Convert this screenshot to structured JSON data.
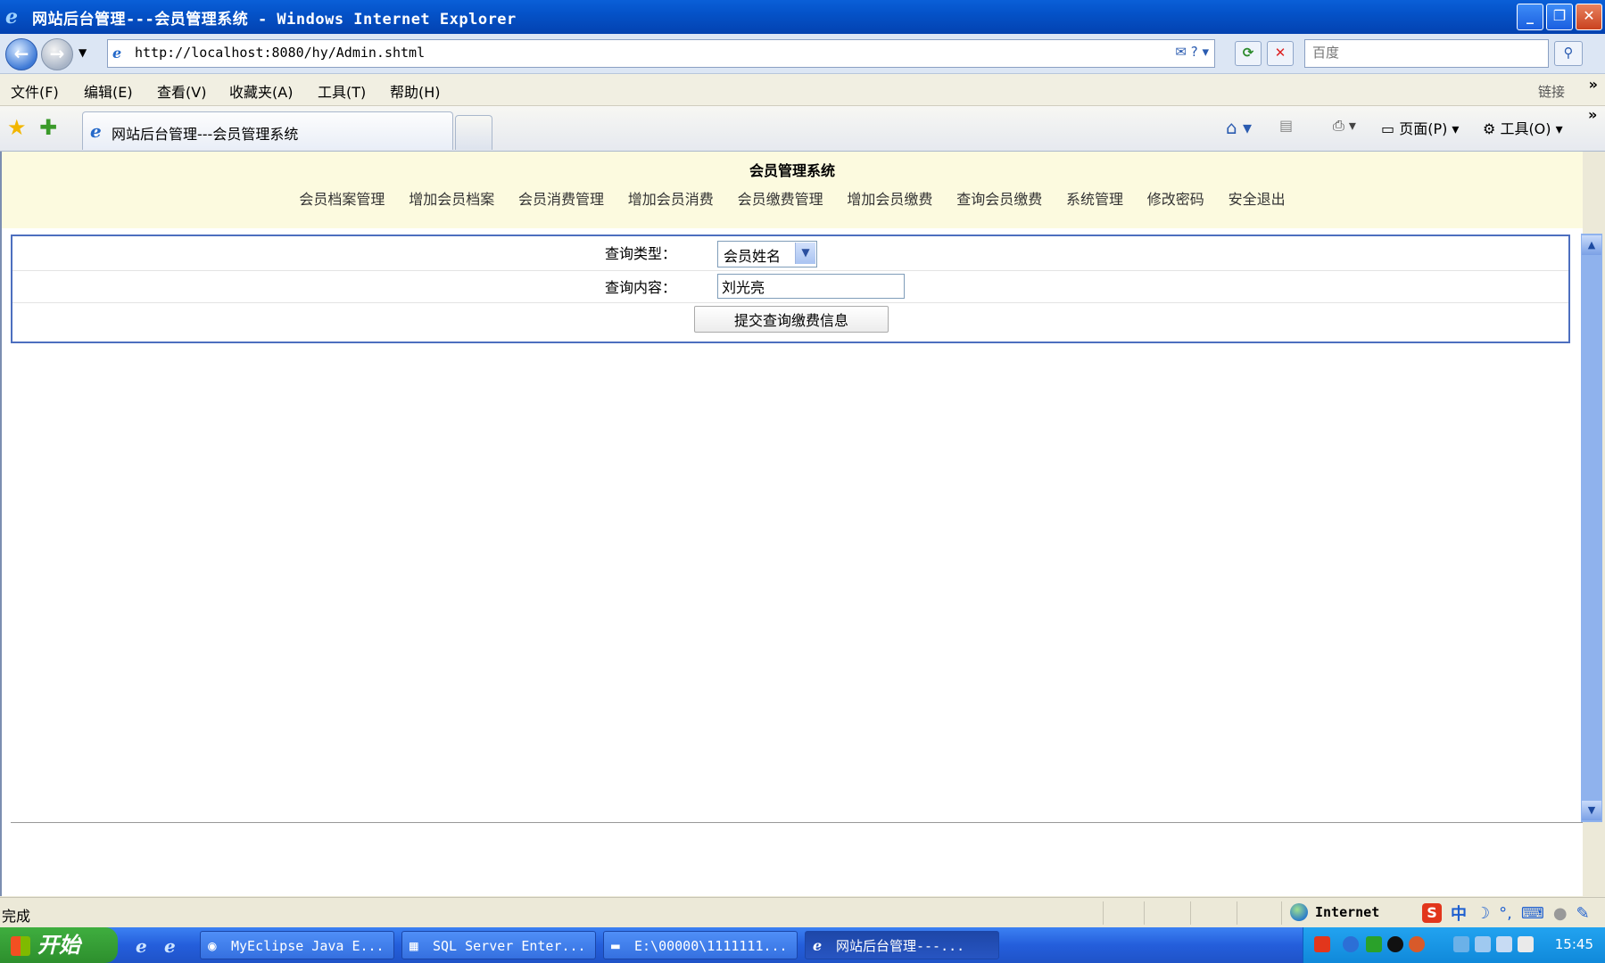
{
  "window": {
    "title": "网站后台管理---会员管理系统 - Windows Internet Explorer"
  },
  "addressbar": {
    "url": "http://localhost:8080/hy/Admin.shtml",
    "search_placeholder": "百度"
  },
  "menubar": {
    "items": [
      "文件(F)",
      "编辑(E)",
      "查看(V)",
      "收藏夹(A)",
      "工具(T)",
      "帮助(H)"
    ],
    "links_label": "链接"
  },
  "tabs": {
    "active_label": "网站后台管理---会员管理系统",
    "page_label": "页面(P)",
    "tools_label": "工具(O)"
  },
  "page": {
    "system_title": "会员管理系统",
    "nav": [
      "会员档案管理",
      "增加会员档案",
      "会员消费管理",
      "增加会员消费",
      "会员缴费管理",
      "增加会员缴费",
      "查询会员缴费",
      "系统管理",
      "修改密码",
      "安全退出"
    ],
    "form": {
      "type_label": "查询类型：",
      "type_value": "会员姓名",
      "content_label": "查询内容：",
      "content_value": "刘光亮",
      "submit_label": "提交查询缴费信息"
    }
  },
  "statusbar": {
    "status": "完成",
    "zone": "Internet"
  },
  "taskbar": {
    "start_label": "开始",
    "tasks": [
      "MyEclipse Java E...",
      "SQL Server Enter...",
      "E:\\00000\\1111111...",
      "网站后台管理---..."
    ],
    "clock": "15:45"
  },
  "ime": {
    "mode": "中"
  }
}
